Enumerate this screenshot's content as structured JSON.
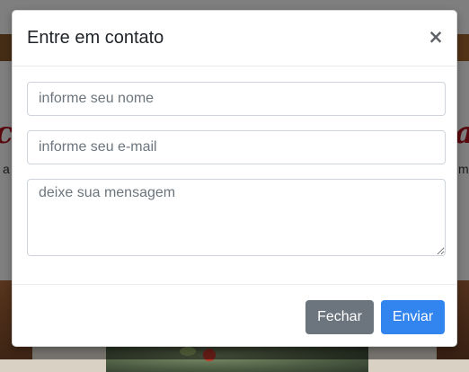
{
  "modal": {
    "title": "Entre em contato",
    "close_symbol": "×",
    "close_icon": "close-icon"
  },
  "form": {
    "name_placeholder": "informe seu nome",
    "email_placeholder": "informe seu e-mail",
    "message_placeholder": "deixe sua mensagem"
  },
  "footer": {
    "close_label": "Fechar",
    "send_label": "Enviar"
  },
  "background": {
    "script_left": "ce",
    "script_right": "a",
    "text_left": "a",
    "text_right": "m"
  },
  "colors": {
    "close_button": "#6c757d",
    "send_button": "#3284ee",
    "backdrop": "rgba(0,0,0,0.5)"
  }
}
